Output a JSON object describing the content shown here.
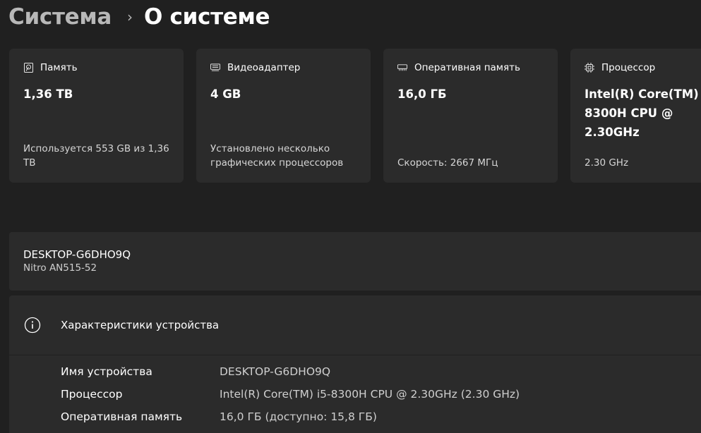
{
  "breadcrumb": {
    "parent": "Система",
    "separator": "›",
    "current": "О системе"
  },
  "cards": [
    {
      "icon": "storage-icon",
      "title": "Память",
      "value": "1,36 TB",
      "sub": "Используется 553 GB из 1,36 TB"
    },
    {
      "icon": "display-adapter-icon",
      "title": "Видеоадаптер",
      "value": "4 GB",
      "sub": "Установлено несколько графических процессоров"
    },
    {
      "icon": "ram-icon",
      "title": "Оперативная память",
      "value": "16,0 ГБ",
      "sub": "Скорость: 2667 МГц"
    },
    {
      "icon": "processor-icon",
      "title": "Процессор",
      "value": "Intel(R) Core(TM) i5-8300H CPU @ 2.30GHz",
      "sub": "2.30 GHz"
    }
  ],
  "device": {
    "name": "DESKTOP-G6DHO9Q",
    "model": "Nitro AN515-52"
  },
  "specs": {
    "icon": "info-icon",
    "title": "Характеристики устройства",
    "rows": [
      {
        "label": "Имя устройства",
        "value": "DESKTOP-G6DHO9Q"
      },
      {
        "label": "Процессор",
        "value": "Intel(R) Core(TM) i5-8300H CPU @ 2.30GHz (2.30 GHz)"
      },
      {
        "label": "Оперативная память",
        "value": "16,0 ГБ (доступно: 15,8 ГБ)"
      }
    ]
  }
}
